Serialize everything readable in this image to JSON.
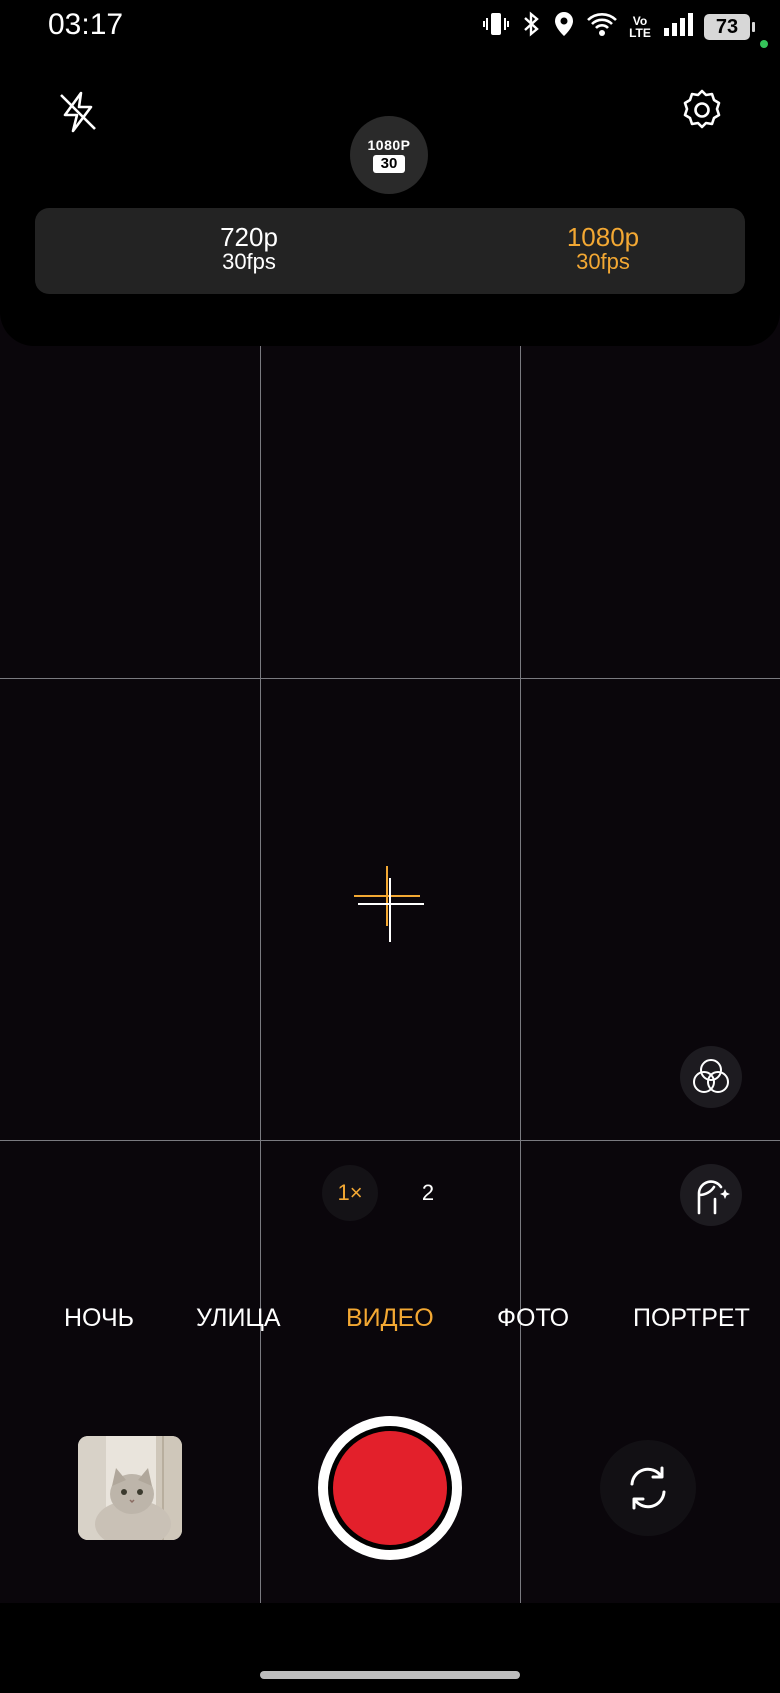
{
  "status_bar": {
    "time": "03:17",
    "battery": "73",
    "icons": [
      "vibrate-icon",
      "bluetooth-icon",
      "location-icon",
      "wifi-icon",
      "volte-icon",
      "signal-icon",
      "battery-icon"
    ],
    "volte_text": "Vo\nLTE"
  },
  "top_bar": {
    "flash_state": "off",
    "resolution_badge": {
      "line1": "1080P",
      "line2": "30"
    }
  },
  "resolution_options": [
    {
      "label": "720p",
      "sub": "30fps",
      "selected": false
    },
    {
      "label": "1080p",
      "sub": "30fps",
      "selected": true
    }
  ],
  "zoom": {
    "options": [
      "1×",
      "2"
    ],
    "active": "1×"
  },
  "modes": [
    "НОЧЬ",
    "УЛИЦА",
    "ВИДЕО",
    "ФОТО",
    "ПОРТРЕТ"
  ],
  "active_mode": "ВИДЕО",
  "colors": {
    "accent": "#f3a833",
    "record": "#e3202b",
    "background": "#0a060b",
    "panel": "#232323"
  }
}
